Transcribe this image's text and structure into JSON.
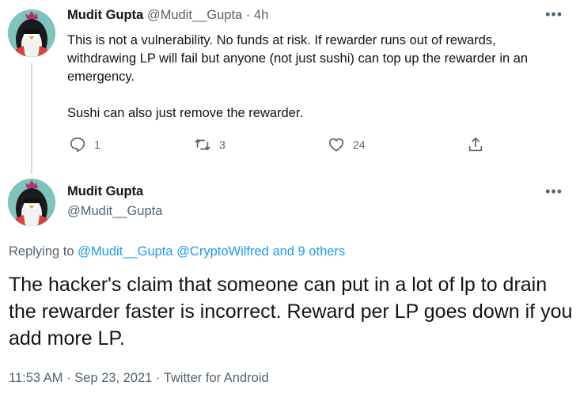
{
  "tweet1": {
    "name": "Mudit Gupta",
    "handle": "@Mudit__Gupta",
    "separator": "·",
    "time": "4h",
    "paragraph1": "This is not a vulnerability. No funds at risk. If rewarder runs out of rewards, withdrawing LP will fail but anyone (not just sushi) can top up the rewarder in an emergency.",
    "paragraph2": "Sushi can also just remove the rewarder.",
    "reply_count": "1",
    "retweet_count": "3",
    "like_count": "24",
    "more_icon": "more-dots-icon"
  },
  "tweet2": {
    "name": "Mudit Gupta",
    "handle": "@Mudit__Gupta",
    "replying_prefix": "Replying to",
    "replying_user1": "@Mudit__Gupta",
    "replying_user2": "@CryptoWilfred",
    "replying_others": "and 9 others",
    "text": "The hacker's claim that someone can put in a lot of lp to drain the rewarder faster is incorrect. Reward per LP goes down if you add more LP.",
    "timestamp": "11:53 AM · Sep 23, 2021 · Twitter for Android"
  },
  "colors": {
    "text": "#0f1419",
    "secondary": "#536471",
    "link": "#1d9bf0",
    "thread_line": "#cfd9de"
  }
}
